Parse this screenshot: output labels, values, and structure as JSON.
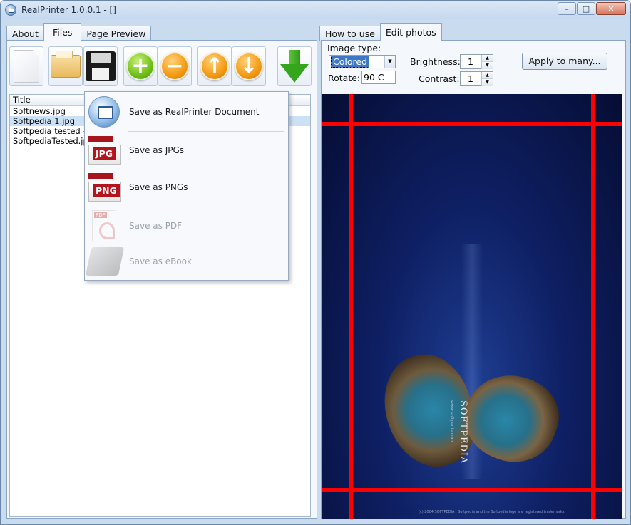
{
  "window": {
    "title": "RealPrinter 1.0.0.1 - []",
    "controls": {
      "minimize": "–",
      "maximize": "□",
      "close": "✕"
    }
  },
  "left_tabs": [
    {
      "label": "About"
    },
    {
      "label": "Files"
    },
    {
      "label": "Page Preview"
    }
  ],
  "active_left_tab": "Files",
  "right_tabs": [
    {
      "label": "How to use"
    },
    {
      "label": "Edit photos"
    }
  ],
  "active_right_tab": "Edit photos",
  "toolbar": {
    "buttons": [
      "new-icon",
      "open-folder-icon",
      "save-icon",
      "add-icon",
      "remove-icon",
      "move-up-icon",
      "move-down-icon",
      "download-icon"
    ],
    "add_glyph": "+",
    "remove_glyph": "−",
    "up_glyph": "↑",
    "down_glyph": "↓"
  },
  "file_list": {
    "header": "Title",
    "rows": [
      {
        "title": "Softnews.jpg",
        "selected": false
      },
      {
        "title": "Softpedia 1.jpg",
        "selected": true
      },
      {
        "title": "Softpedia tested - ne",
        "selected": false
      },
      {
        "title": "SoftpediaTested.jpg",
        "selected": false
      }
    ]
  },
  "save_menu": {
    "items": [
      {
        "label": "Save as RealPrinter Document",
        "icon": "realprinter-icon",
        "enabled": true
      },
      {
        "label": "Save as JPGs",
        "icon": "jpg-icon",
        "tag": "JPG",
        "enabled": true
      },
      {
        "label": "Save as PNGs",
        "icon": "png-icon",
        "tag": "PNG",
        "enabled": true
      },
      {
        "label": "Save as PDF",
        "icon": "pdf-icon",
        "enabled": false
      },
      {
        "label": "Save as eBook",
        "icon": "ebook-icon",
        "enabled": false
      }
    ]
  },
  "edit_photos": {
    "image_type_label": "Image type:",
    "image_type_value": "Colored",
    "rotate_label": "Rotate:",
    "rotate_value": "90 C",
    "brightness_label": "Brightness:",
    "brightness_value": "1",
    "contrast_label": "Contrast:",
    "contrast_value": "1",
    "apply_button": "Apply to many..."
  },
  "preview": {
    "brand_text": "SOFTPEDIA",
    "brand_small": "www.softpedia.com",
    "footer_text": "(c) 2004 SOFTPEDIA . Softpedia and the Softpedia logo are registered trademarks.",
    "guide_color": "#ff0000",
    "background_color": "#0b1a55"
  }
}
